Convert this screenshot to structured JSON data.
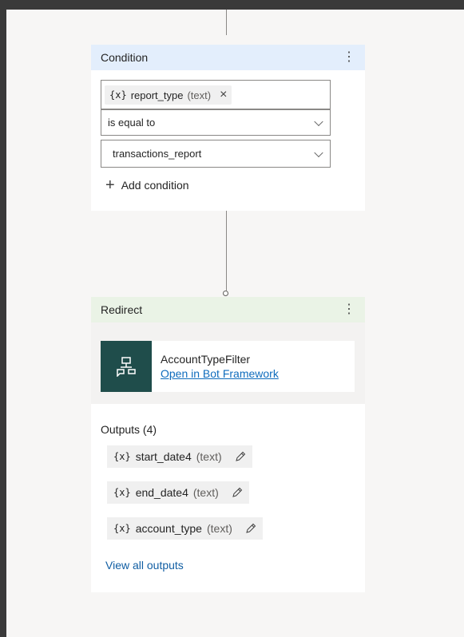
{
  "condition": {
    "header_title": "Condition",
    "menu_glyph": "⋮",
    "variable": {
      "glyph": "{x}",
      "name": "report_type",
      "type": "(text)",
      "remove_glyph": "×"
    },
    "operator": "is equal to",
    "value": "transactions_report",
    "add_condition_label": "Add condition"
  },
  "redirect": {
    "header_title": "Redirect",
    "menu_glyph": "⋮",
    "topic_name": "AccountTypeFilter",
    "open_link": "Open in Bot Framework",
    "outputs_title": "Outputs (4)",
    "outputs": [
      {
        "glyph": "{x}",
        "name": "start_date4",
        "type": "(text)"
      },
      {
        "glyph": "{x}",
        "name": "end_date4",
        "type": "(text)"
      },
      {
        "glyph": "{x}",
        "name": "account_type",
        "type": "(text)"
      }
    ],
    "view_all_label": "View all outputs"
  },
  "colors": {
    "condition_header": "#e3eefc",
    "redirect_header": "#eaf3e6",
    "bot_icon_bg": "#1f4d4b",
    "link": "#0f6cbd"
  }
}
